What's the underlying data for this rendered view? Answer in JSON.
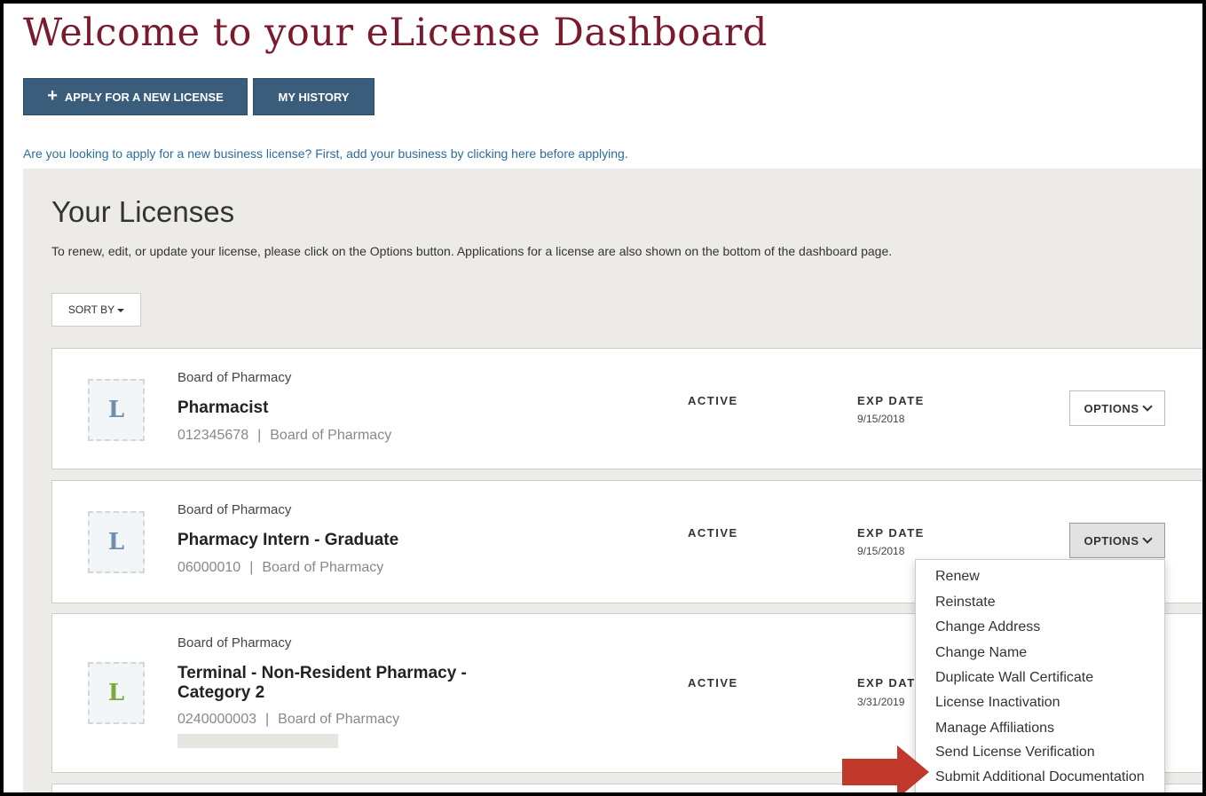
{
  "header": {
    "title": "Welcome to your eLicense Dashboard",
    "apply_button": {
      "icon": "plus-icon",
      "label": "APPLY FOR A NEW LICENSE"
    },
    "history_button": "MY HISTORY",
    "help_link": "Are you looking to apply for a new business license? First, add your business by clicking here before applying."
  },
  "licenses": {
    "heading": "Your Licenses",
    "description": "To renew, edit, or update your license, please click on the Options button. Applications for a license are also shown on the bottom of the dashboard page.",
    "sort_label": "SORT BY",
    "exp_label": "EXP DATE",
    "cards": [
      {
        "board": "Board of Pharmacy",
        "name": "Pharmacist",
        "number": "012345678",
        "separator": "|",
        "board_short": "Board of Pharmacy",
        "status": "ACTIVE",
        "exp_label": "EXP DATE",
        "exp_date": "9/15/2018",
        "options_label": "OPTIONS"
      },
      {
        "board": "Board of Pharmacy",
        "name": "Pharmacy Intern - Graduate",
        "number": "06000010",
        "separator": "|",
        "board_short": "Board of Pharmacy",
        "status": "ACTIVE",
        "exp_label": "EXP DATE",
        "exp_date": "9/15/2018",
        "options_label": "OPTIONS"
      },
      {
        "board": "Board of Pharmacy",
        "name": "Terminal - Non-Resident Pharmacy - Category 2",
        "number": "0240000003",
        "separator": "|",
        "board_short": "Board of Pharmacy",
        "status": "ACTIVE",
        "exp_label": "EXP DAT",
        "exp_date": "3/31/2019"
      }
    ]
  },
  "options_menu": {
    "items": [
      "Renew",
      "Reinstate",
      "Change Address",
      "Change Name",
      "Duplicate Wall Certificate",
      "License Inactivation",
      "Manage Affiliations",
      "Send License Verification",
      "Submit Additional Documentation"
    ]
  },
  "colors": {
    "title": "#7a1a2e",
    "button": "#3a5d7c",
    "link": "#2c6c9e",
    "arrow": "#c0392b"
  },
  "icons": {
    "stamp": "license-stamp-icon",
    "stamp_glyph": "L"
  }
}
